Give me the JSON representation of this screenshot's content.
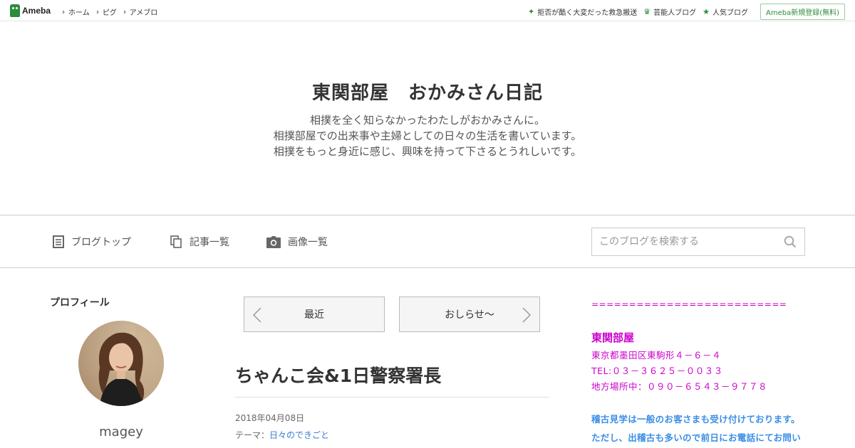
{
  "topbar": {
    "logo_text": "Ameba",
    "nav": [
      "ホーム",
      "ピグ",
      "アメブロ"
    ],
    "right_links": [
      {
        "icon": "sparkle-icon",
        "label": "拒否が酷く大変だった救急搬送"
      },
      {
        "icon": "crown-icon",
        "label": "芸能人ブログ"
      },
      {
        "icon": "star-icon",
        "label": "人気ブログ"
      }
    ],
    "signup_label": "Ameba新規登録(無料)"
  },
  "header": {
    "title": "東関部屋　おかみさん日記",
    "description": [
      "相撲を全く知らなかったわたしがおかみさんに。",
      "相撲部屋での出来事や主婦としての日々の生活を書いています。",
      "相撲をもっと身近に感じ、興味を持って下さるとうれしいです。"
    ]
  },
  "navbar": {
    "items": [
      {
        "icon": "document-icon",
        "label": "ブログトップ"
      },
      {
        "icon": "copy-icon",
        "label": "記事一覧"
      },
      {
        "icon": "camera-icon",
        "label": "画像一覧"
      }
    ],
    "search_placeholder": "このブログを検索する"
  },
  "profile": {
    "heading": "プロフィール",
    "name": "magey"
  },
  "entry": {
    "prev_label": "最近",
    "next_label": "おしらせ〜",
    "title": "ちゃんこ会&1日警察署長",
    "date": "2018年04月08日",
    "theme_prefix": "テーマ：",
    "theme": "日々のできごと"
  },
  "sidebar": {
    "equals": "==========================",
    "name": "東関部屋",
    "address": "東京都墨田区東駒形４－６－４",
    "tel": "TEL:０３－３６２５－００３３",
    "regional": "地方場所中：０９０－６５４３－９７７８",
    "notice1": "稽古見学は一般のお客さまも受け付けております。",
    "notice2": "ただし、出稽古も多いので前日にお電話にてお問い"
  },
  "colors": {
    "ameba_green": "#2d8c3c",
    "sidebar_magenta": "#cc00cc",
    "sidebar_blue": "#3a8ee6",
    "link_blue": "#3a7bd5"
  }
}
